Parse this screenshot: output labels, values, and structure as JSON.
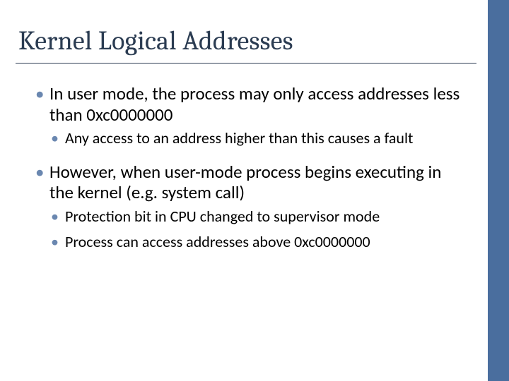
{
  "title": "Kernel Logical Addresses",
  "bullets": {
    "b1": "In user mode, the process may only access addresses less than 0xc0000000",
    "b1a": "Any access to an address higher than this causes a fault",
    "b2": "However, when user-mode process begins executing in the kernel (e.g. system call)",
    "b2a": "Protection bit in CPU changed to supervisor mode",
    "b2b": "Process can access addresses above 0xc0000000"
  },
  "glyphs": {
    "dot": "•"
  }
}
